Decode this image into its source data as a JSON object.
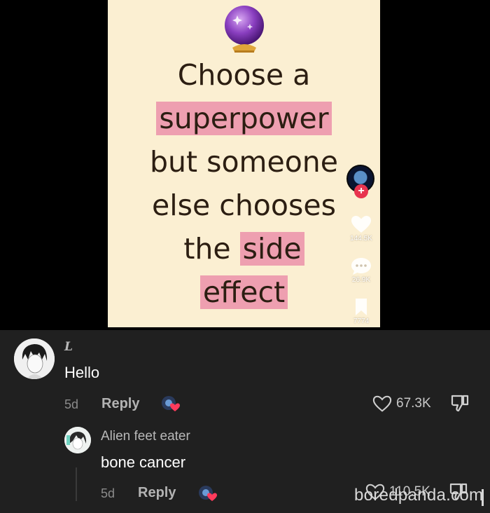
{
  "video": {
    "caption": {
      "line1": "Choose a",
      "line2": "superpower",
      "line3": "but someone",
      "line4": "else chooses",
      "line5_a": "the ",
      "line5_b": "side",
      "line6": "effect"
    },
    "rail": {
      "follow": "+",
      "likes": "144.5K",
      "comments": "26.9K",
      "saves": "7774"
    },
    "icons": [
      "crystal-ball-icon",
      "heart-icon",
      "speech-bubble-icon",
      "bookmark-icon"
    ],
    "colors": {
      "background": "#fbefd2",
      "highlight": "#ee9fb0",
      "text": "#2c1e12"
    }
  },
  "comments": [
    {
      "username": "L",
      "text": "Hello",
      "age": "5d",
      "reply_label": "Reply",
      "likes": "67.3K"
    },
    {
      "username": "Alien feet eater",
      "text": "bone cancer",
      "age": "5d",
      "reply_label": "Reply",
      "likes": "110.5K"
    }
  ],
  "watermark": "boredpanda.com"
}
